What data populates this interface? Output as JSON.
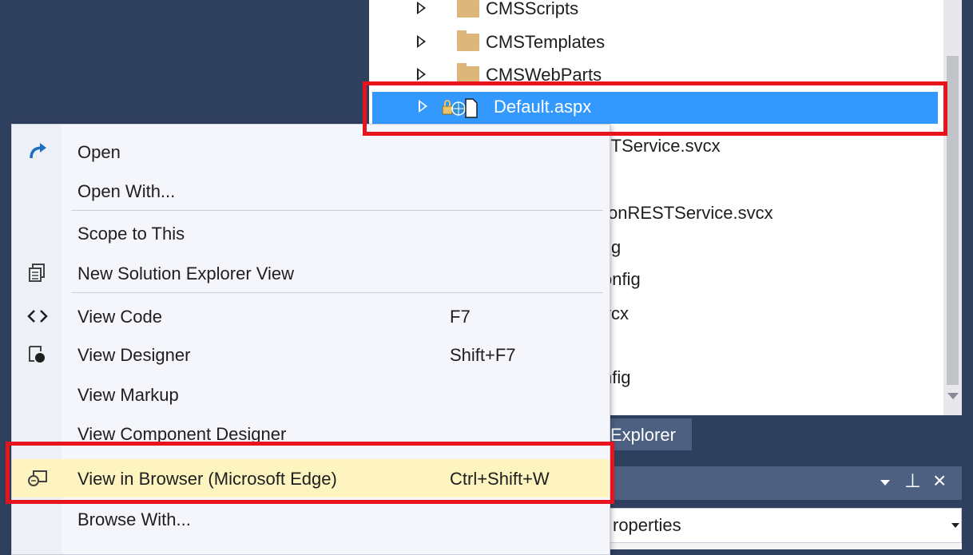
{
  "tree": {
    "items": [
      {
        "label": "CMSScripts"
      },
      {
        "label": "CMSTemplates"
      },
      {
        "label": "CMSWebParts"
      },
      {
        "label": "Default.aspx"
      }
    ],
    "partial_items": [
      "STService.svcx",
      "tionRESTService.svcx",
      "fig",
      "onfig",
      "vcx",
      "nfig"
    ]
  },
  "menu": {
    "items": [
      {
        "label": "Open",
        "shortcut": "",
        "icon": "open-arrow-icon"
      },
      {
        "label": "Open With...",
        "shortcut": ""
      },
      {
        "label": "Scope to This",
        "shortcut": ""
      },
      {
        "label": "New Solution Explorer View",
        "shortcut": "",
        "icon": "new-view-icon"
      },
      {
        "label": "View Code",
        "shortcut": "F7",
        "icon": "code-brackets-icon"
      },
      {
        "label": "View Designer",
        "shortcut": "Shift+F7",
        "icon": "designer-icon"
      },
      {
        "label": "View Markup",
        "shortcut": ""
      },
      {
        "label": "View Component Designer",
        "shortcut": ""
      },
      {
        "label": "View in Browser (Microsoft Edge)",
        "shortcut": "Ctrl+Shift+W",
        "icon": "browser-icon",
        "highlighted": true
      },
      {
        "label": "Browse With...",
        "shortcut": ""
      }
    ]
  },
  "dock": {
    "explorer_tab": "Explorer",
    "properties_select": "roperties"
  },
  "colors": {
    "selection": "#3399ff",
    "annotation_red": "#e8141c",
    "menu_highlight": "#fdf4bf",
    "frame_bg": "#2f3f5e"
  }
}
